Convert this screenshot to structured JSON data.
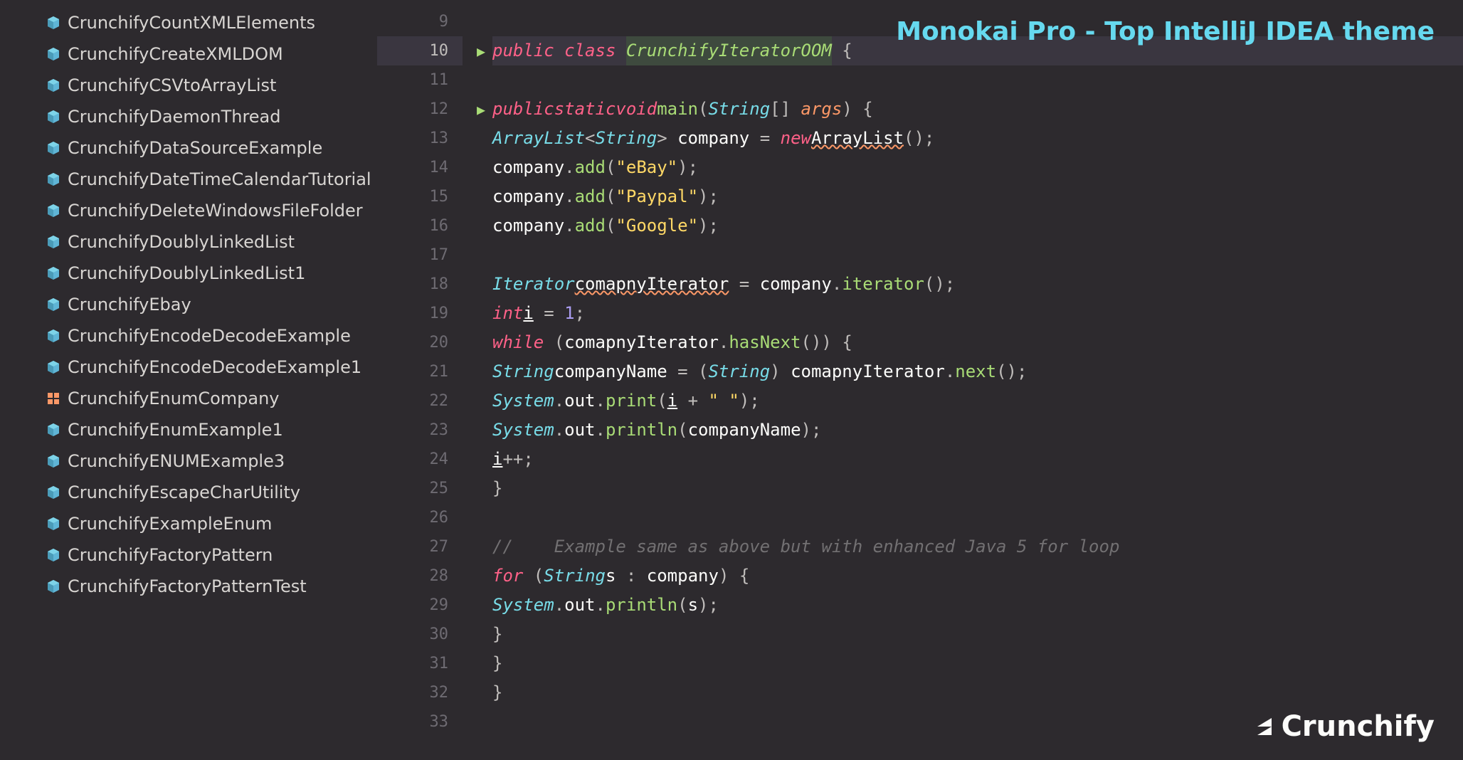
{
  "sidebar": {
    "files": [
      {
        "name": "CrunchifyCountXMLElements",
        "type": "class"
      },
      {
        "name": "CrunchifyCreateXMLDOM",
        "type": "class"
      },
      {
        "name": "CrunchifyCSVtoArrayList",
        "type": "class"
      },
      {
        "name": "CrunchifyDaemonThread",
        "type": "class"
      },
      {
        "name": "CrunchifyDataSourceExample",
        "type": "class"
      },
      {
        "name": "CrunchifyDateTimeCalendarTutorial",
        "type": "class"
      },
      {
        "name": "CrunchifyDeleteWindowsFileFolder",
        "type": "class"
      },
      {
        "name": "CrunchifyDoublyLinkedList",
        "type": "class"
      },
      {
        "name": "CrunchifyDoublyLinkedList1",
        "type": "class"
      },
      {
        "name": "CrunchifyEbay",
        "type": "class"
      },
      {
        "name": "CrunchifyEncodeDecodeExample",
        "type": "class"
      },
      {
        "name": "CrunchifyEncodeDecodeExample1",
        "type": "class"
      },
      {
        "name": "CrunchifyEnumCompany",
        "type": "enum"
      },
      {
        "name": "CrunchifyEnumExample1",
        "type": "class"
      },
      {
        "name": "CrunchifyENUMExample3",
        "type": "class"
      },
      {
        "name": "CrunchifyEscapeCharUtility",
        "type": "class"
      },
      {
        "name": "CrunchifyExampleEnum",
        "type": "class"
      },
      {
        "name": "CrunchifyFactoryPattern",
        "type": "class"
      },
      {
        "name": "CrunchifyFactoryPatternTest",
        "type": "class"
      }
    ]
  },
  "gutter": {
    "startLine": 9,
    "endLine": 33,
    "active": 10,
    "runMarkers": [
      10,
      12
    ]
  },
  "code": {
    "className": "CrunchifyIteratorOOM",
    "lines": {
      "9": "",
      "10_pre": "public class ",
      "10_class": "CrunchifyIteratorOOM",
      "10_post": " {",
      "11": "",
      "12": "    public static void main(String[] args) {",
      "13": "        ArrayList<String> company = new ArrayList();",
      "14": "        company.add(\"eBay\");",
      "15": "        company.add(\"Paypal\");",
      "16": "        company.add(\"Google\");",
      "17": "",
      "18": "        Iterator comapnyIterator = company.iterator();",
      "19": "        int i = 1;",
      "20": "        while (comapnyIterator.hasNext()) {",
      "21": "            String companyName = (String) comapnyIterator.next();",
      "22": "            System.out.print(i + \" \");",
      "23": "            System.out.println(companyName);",
      "24": "            i++;",
      "25": "        }",
      "26": "",
      "27": "//    Example same as above but with enhanced Java 5 for loop",
      "28": "        for (String s : company) {",
      "29": "            System.out.println(s);",
      "30": "        }",
      "31": "    }",
      "32": "}",
      "33": ""
    },
    "tokens": {
      "t12_public": "public",
      "t12_static": "static",
      "t12_void": "void",
      "t12_main": "main",
      "t12_string": "String",
      "t12_args": "args",
      "t13_arraylist": "ArrayList",
      "t13_string": "String",
      "t13_company": "company",
      "t13_new": "new",
      "t13_arraylist2": "ArrayList",
      "t14_company": "company",
      "t14_add": "add",
      "t14_ebay": "\"eBay\"",
      "t15_company": "company",
      "t15_add": "add",
      "t15_paypal": "\"Paypal\"",
      "t16_company": "company",
      "t16_add": "add",
      "t16_google": "\"Google\"",
      "t18_iterator": "Iterator",
      "t18_var": "comapnyIterator",
      "t18_company": "company",
      "t18_iter": "iterator",
      "t19_int": "int",
      "t19_i": "i",
      "t19_one": "1",
      "t20_while": "while",
      "t20_var": "comapnyIterator",
      "t20_hasnext": "hasNext",
      "t21_string": "String",
      "t21_name": "companyName",
      "t21_string2": "String",
      "t21_var": "comapnyIterator",
      "t21_next": "next",
      "t22_system": "System",
      "t22_out": "out",
      "t22_print": "print",
      "t22_i": "i",
      "t22_space": "\" \"",
      "t23_system": "System",
      "t23_out": "out",
      "t23_println": "println",
      "t23_name": "companyName",
      "t24_i": "i",
      "t27_comment": "//    Example same as above but with enhanced Java 5 for loop",
      "t28_for": "for",
      "t28_string": "String",
      "t28_s": "s",
      "t28_company": "company",
      "t29_system": "System",
      "t29_out": "out",
      "t29_println": "println",
      "t29_s": "s"
    }
  },
  "overlay": {
    "title": "Monokai Pro - Top IntelliJ IDEA theme",
    "logo": "Crunchify"
  },
  "colors": {
    "bg": "#2d2a2e",
    "fg": "#fcfcfa",
    "keyword": "#ff6188",
    "type": "#78dce8",
    "method": "#a9dc76",
    "string": "#ffd866",
    "param": "#fc9867",
    "comment": "#727072",
    "number": "#ab9df2",
    "gutter": "#6e6b72"
  }
}
